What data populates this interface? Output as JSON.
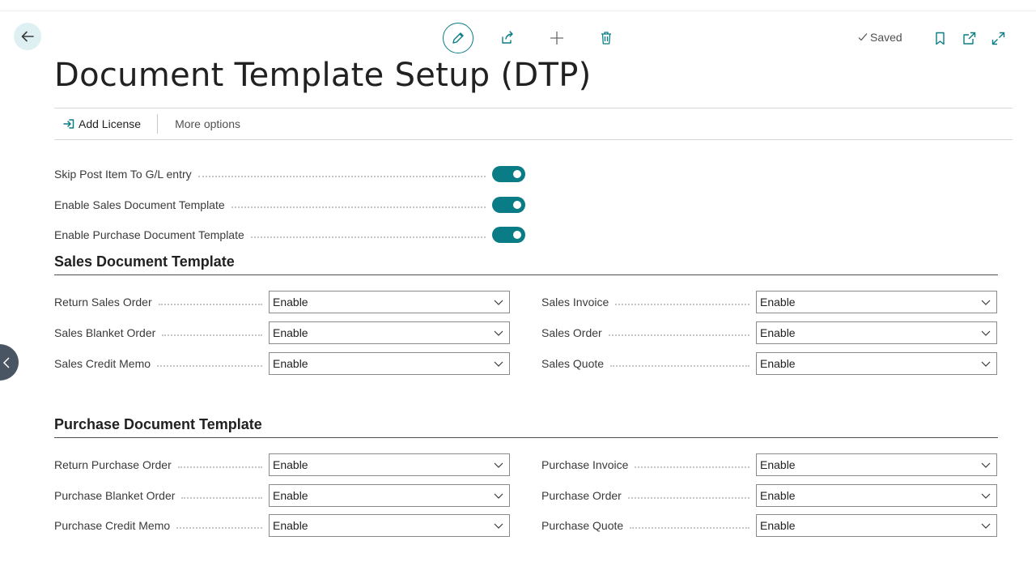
{
  "header": {
    "saved_label": "Saved",
    "icons": [
      "back-arrow-icon",
      "pencil-icon",
      "share-icon",
      "plus-icon",
      "trash-icon",
      "checkmark-icon",
      "bookmark-icon",
      "open-new-window-icon",
      "expand-icon"
    ]
  },
  "page": {
    "title": "Document Template Setup (DTP)"
  },
  "actionbar": {
    "add_license": "Add License",
    "more_options": "More options"
  },
  "toggles": [
    {
      "label": "Skip Post Item To G/L entry",
      "value": true
    },
    {
      "label": "Enable Sales Document Template",
      "value": true
    },
    {
      "label": "Enable Purchase Document Template",
      "value": true
    }
  ],
  "sales": {
    "title": "Sales Document Template",
    "left": [
      {
        "label": "Return Sales Order",
        "value": "Enable"
      },
      {
        "label": "Sales Blanket Order",
        "value": "Enable"
      },
      {
        "label": "Sales Credit Memo",
        "value": "Enable"
      }
    ],
    "right": [
      {
        "label": "Sales Invoice",
        "value": "Enable"
      },
      {
        "label": "Sales Order",
        "value": "Enable"
      },
      {
        "label": "Sales Quote",
        "value": "Enable"
      }
    ]
  },
  "purchase": {
    "title": "Purchase Document Template",
    "left": [
      {
        "label": "Return Purchase Order",
        "value": "Enable"
      },
      {
        "label": "Purchase Blanket Order",
        "value": "Enable"
      },
      {
        "label": "Purchase Credit Memo",
        "value": "Enable"
      }
    ],
    "right": [
      {
        "label": "Purchase Invoice",
        "value": "Enable"
      },
      {
        "label": "Purchase Order",
        "value": "Enable"
      },
      {
        "label": "Purchase Quote",
        "value": "Enable"
      }
    ]
  },
  "colors": {
    "accent": "#0a7c86",
    "back_button_bg": "#dff0f3",
    "side_handle_bg": "#4a5563"
  }
}
